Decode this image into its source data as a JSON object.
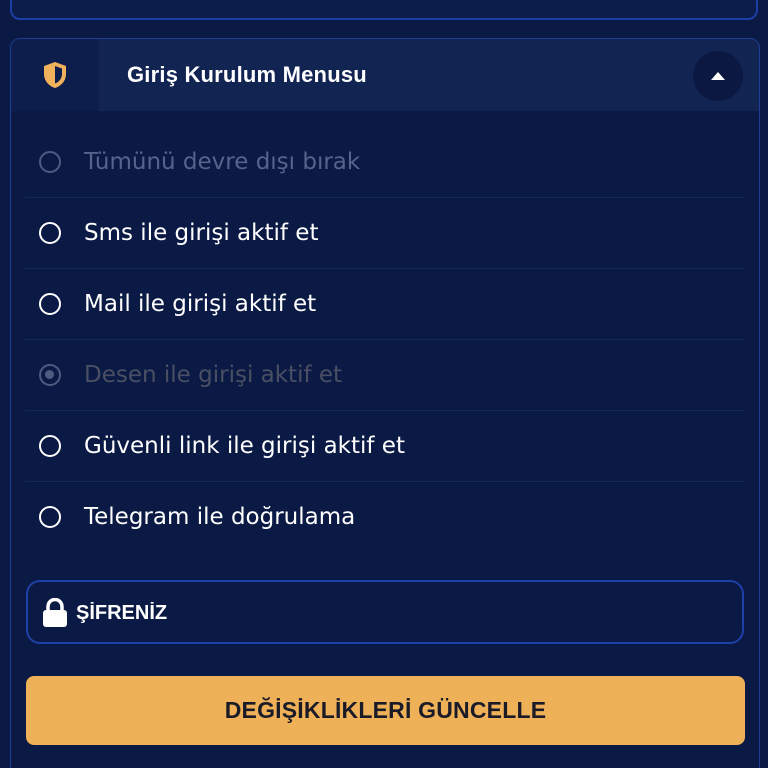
{
  "header": {
    "title": "Giriş Kurulum Menusu",
    "icon": "shield-icon",
    "collapse_icon": "caret-up-icon"
  },
  "options": [
    {
      "label": "Tümünü devre dışı bırak",
      "state": "disabled",
      "checked": false
    },
    {
      "label": "Sms ile girişi aktif et",
      "state": "enabled",
      "checked": false
    },
    {
      "label": "Mail ile girişi aktif et",
      "state": "enabled",
      "checked": false
    },
    {
      "label": "Desen ile girişi aktif et",
      "state": "disabled",
      "checked": true
    },
    {
      "label": "Güvenli link ile girişi aktif et",
      "state": "enabled",
      "checked": false
    },
    {
      "label": "Telegram ile doğrulama",
      "state": "enabled",
      "checked": false
    }
  ],
  "password": {
    "placeholder": "ŞİFRENİZ",
    "value": "",
    "icon": "lock-icon"
  },
  "submit": {
    "label": "DEĞİŞİKLİKLERİ GÜNCELLE"
  },
  "colors": {
    "background": "#0b1a45",
    "accent": "#efb158",
    "border": "#1e40a8"
  }
}
